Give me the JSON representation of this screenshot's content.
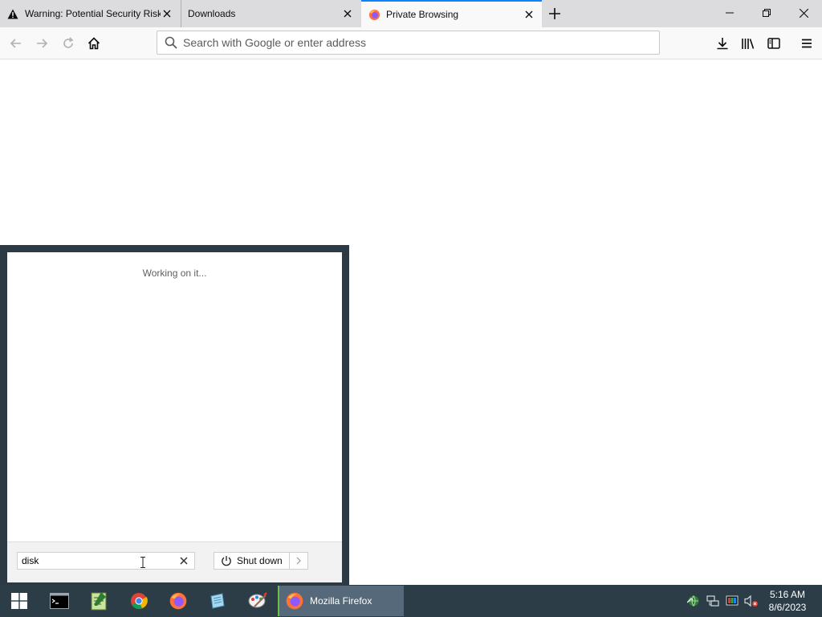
{
  "browser": {
    "tabs": [
      {
        "title": "Warning: Potential Security Risk Ahead",
        "icon": "warning-icon"
      },
      {
        "title": "Downloads",
        "icon": ""
      },
      {
        "title": "Private Browsing",
        "icon": "firefox-icon"
      }
    ],
    "urlbar": {
      "placeholder": "Search with Google or enter address",
      "value": ""
    },
    "accent_color": "#0a84ff"
  },
  "start_menu": {
    "status_text": "Working on it...",
    "search": {
      "value": "disk"
    },
    "shutdown_label": "Shut down"
  },
  "taskbar": {
    "pinned": [
      "start-button",
      "command-prompt",
      "notepad",
      "chrome",
      "firefox",
      "app-5",
      "paint"
    ],
    "active_app_label": "Mozilla Firefox",
    "clock": {
      "time": "5:16 AM",
      "date": "8/6/2023"
    }
  }
}
